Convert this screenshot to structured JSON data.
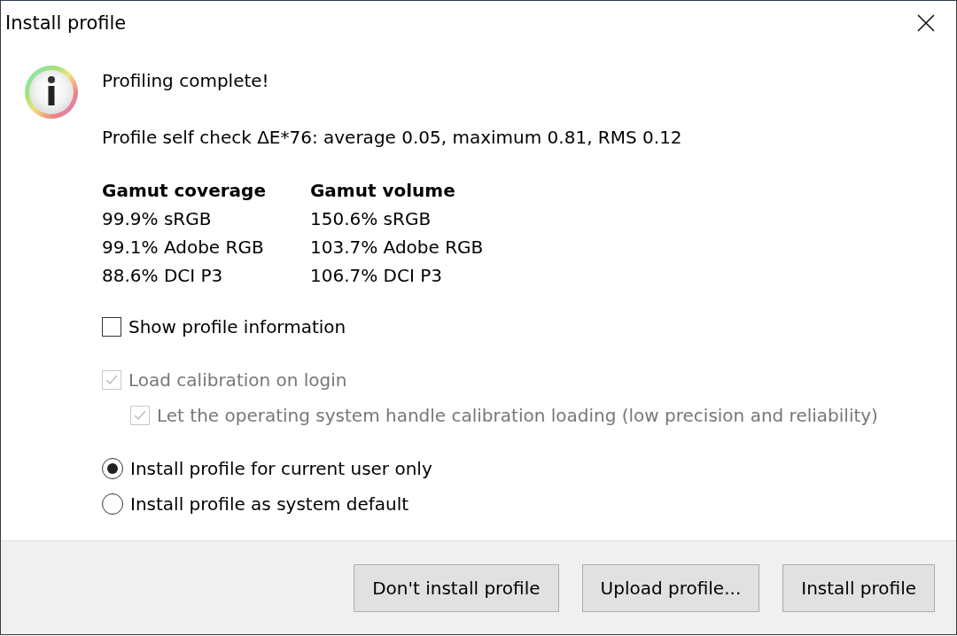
{
  "window": {
    "title": "Install profile"
  },
  "heading": "Profiling complete!",
  "self_check": "Profile self check ΔE*76: average 0.05, maximum 0.81, RMS 0.12",
  "gamut_columns": [
    {
      "heading": "Gamut coverage",
      "items": [
        "99.9% sRGB",
        "99.1% Adobe RGB",
        "88.6% DCI P3"
      ]
    },
    {
      "heading": "Gamut volume",
      "items": [
        "150.6% sRGB",
        "103.7% Adobe RGB",
        "106.7% DCI P3"
      ]
    }
  ],
  "info_checkbox": {
    "label": "Show profile information",
    "checked": false,
    "disabled": false
  },
  "calibration_checkboxes": [
    {
      "label": "Load calibration on login",
      "checked": true,
      "disabled": true,
      "children": [
        {
          "label": "Let the operating system handle calibration loading (low precision and reliability)",
          "checked": true,
          "disabled": true
        }
      ]
    }
  ],
  "install_options": [
    {
      "label": "Install profile for current user only",
      "selected": true
    },
    {
      "label": "Install profile as system default",
      "selected": false
    }
  ],
  "buttons": [
    "Don't install profile",
    "Upload profile...",
    "Install profile"
  ]
}
